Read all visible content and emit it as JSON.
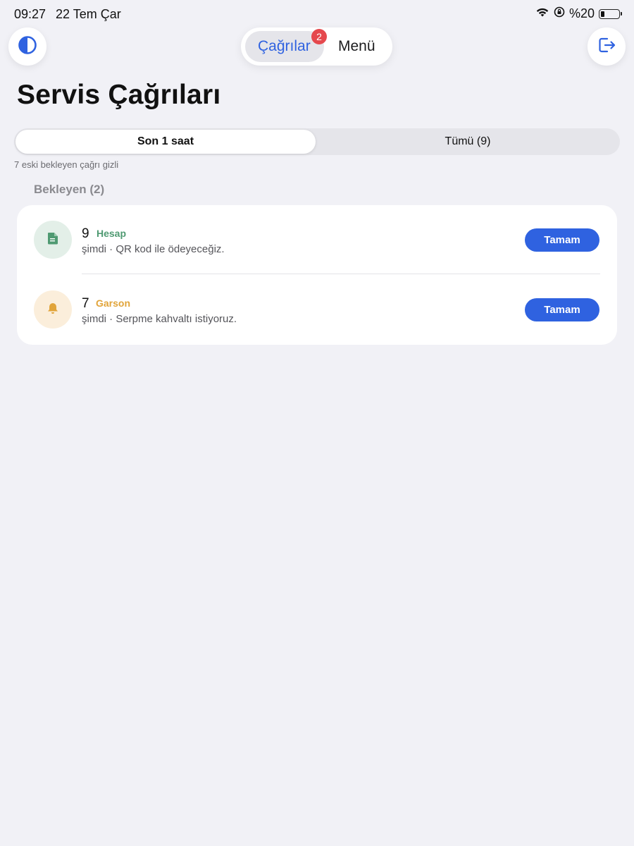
{
  "status_bar": {
    "time": "09:27",
    "date": "22 Tem Çar",
    "battery_text": "%20",
    "battery_level": 0.2,
    "icons": [
      "wifi-icon",
      "orientation-lock-icon",
      "battery-icon"
    ]
  },
  "top_bar": {
    "theme_icon": "half-circle-contrast-icon",
    "logout_icon": "logout-icon",
    "tabs": [
      {
        "label": "Çağrılar",
        "badge": "2",
        "active": true
      },
      {
        "label": "Menü",
        "active": false
      }
    ]
  },
  "page": {
    "title": "Servis Çağrıları",
    "filters": [
      {
        "label": "Son 1 saat",
        "active": true
      },
      {
        "label": "Tümü (9)",
        "active": false
      }
    ],
    "hidden_note": "7 eski bekleyen çağrı gizli",
    "section_title": "Bekleyen (2)"
  },
  "calls": [
    {
      "table": "9",
      "type": "Hesap",
      "type_color": "#4f9a72",
      "icon": "document-icon",
      "time": "şimdi",
      "message": "QR kod ile ödeyeceğiz.",
      "detail": "şimdi · QR kod ile ödeyeceğiz.",
      "action": "Tamam"
    },
    {
      "table": "7",
      "type": "Garson",
      "type_color": "#e1a43a",
      "icon": "bell-icon",
      "time": "şimdi",
      "message": "Serpme kahvaltı istiyoruz.",
      "detail": "şimdi · Serpme kahvaltı istiyoruz.",
      "action": "Tamam"
    }
  ],
  "colors": {
    "accent": "#2f62e0",
    "badge": "#e5484d",
    "background": "#f1f1f6"
  }
}
